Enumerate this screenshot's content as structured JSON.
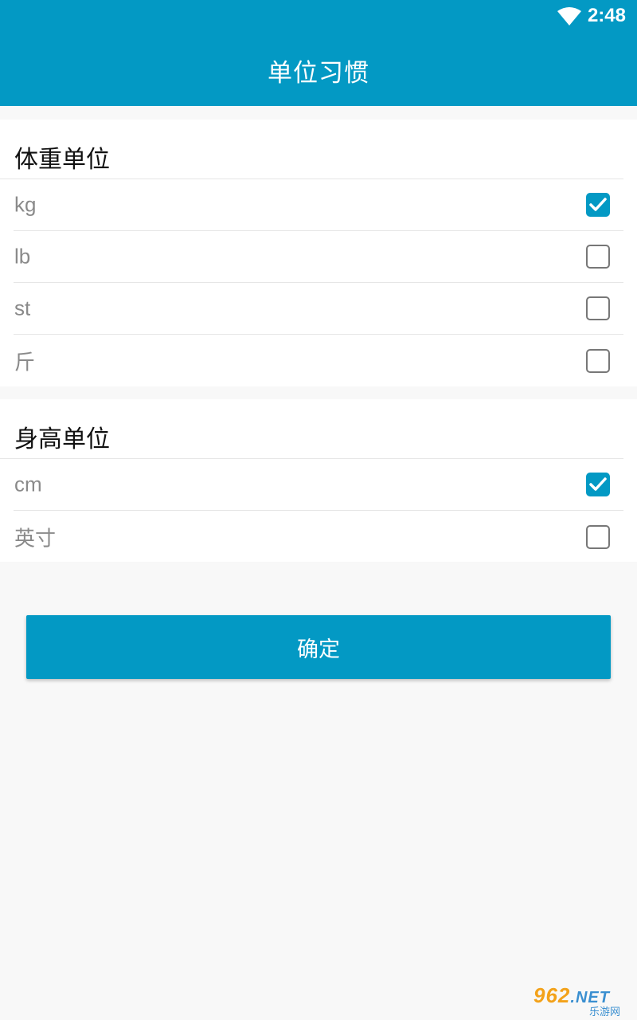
{
  "status": {
    "time": "2:48"
  },
  "appbar": {
    "title": "单位习惯"
  },
  "weight": {
    "header": "体重单位",
    "options": [
      {
        "label": "kg",
        "checked": true
      },
      {
        "label": "lb",
        "checked": false
      },
      {
        "label": "st",
        "checked": false
      },
      {
        "label": "斤",
        "checked": false
      }
    ]
  },
  "height": {
    "header": "身高单位",
    "options": [
      {
        "label": "cm",
        "checked": true
      },
      {
        "label": "英寸",
        "checked": false
      }
    ]
  },
  "confirm_label": "确定",
  "watermark": {
    "brand": "962",
    "net": ".NET",
    "sub": "乐游网"
  },
  "colors": {
    "primary": "#0399c4",
    "background": "#f8f8f8",
    "label_gray": "#8a8a8a"
  }
}
